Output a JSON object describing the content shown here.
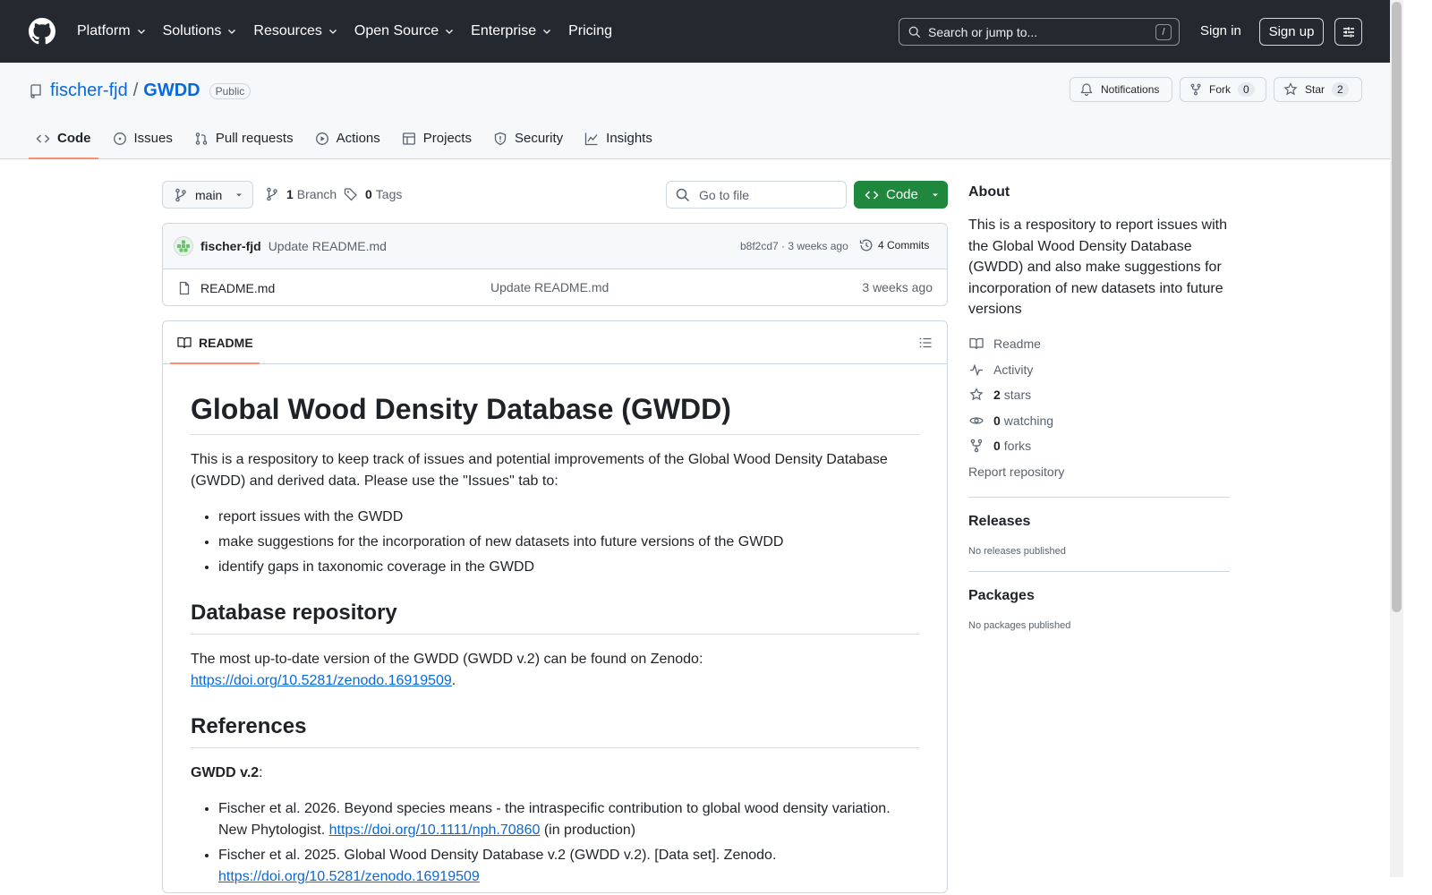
{
  "header": {
    "nav": [
      "Platform",
      "Solutions",
      "Resources",
      "Open Source",
      "Enterprise"
    ],
    "pricing": "Pricing",
    "search_placeholder": "Search or jump to...",
    "search_shortcut": "/",
    "sign_in": "Sign in",
    "sign_up": "Sign up"
  },
  "repo": {
    "owner": "fischer-fjd",
    "separator": "/",
    "name": "GWDD",
    "visibility": "Public",
    "notifications_label": "Notifications",
    "fork_label": "Fork",
    "fork_count": "0",
    "star_label": "Star",
    "star_count": "2",
    "tabs": [
      "Code",
      "Issues",
      "Pull requests",
      "Actions",
      "Projects",
      "Security",
      "Insights"
    ]
  },
  "toolbar": {
    "branch": "main",
    "branch_count": "1",
    "branch_label": "Branch",
    "tag_count": "0",
    "tag_label": "Tags",
    "goto_placeholder": "Go to file",
    "code_button": "Code"
  },
  "latest_commit": {
    "author": "fischer-fjd",
    "message": "Update README.md",
    "meta": "b8f2cd7 · 3 weeks ago",
    "commits_label": "4 Commits"
  },
  "files": [
    {
      "name": "README.md",
      "message": "Update README.md",
      "date": "3 weeks ago"
    }
  ],
  "readme": {
    "tab_label": "README",
    "title": "Global Wood Density Database (GWDD)",
    "intro": "This is a respository to keep track of issues and potential improvements of the Global Wood Density Database (GWDD) and derived data. Please use the \"Issues\" tab to:",
    "bullets": [
      "report issues with the GWDD",
      "make suggestions for the incorporation of new datasets into future versions of the GWDD",
      "identify gaps in taxonomic coverage in the GWDD"
    ],
    "h_database": "Database repository",
    "db_text": "The most up-to-date version of the GWDD (GWDD v.2) can be found on Zenodo:",
    "db_link": "https://doi.org/10.5281/zenodo.16919509",
    "db_after": ".",
    "h_references": "References",
    "ref_heading": "GWDD v.2",
    "ref_colon": ":",
    "refs": [
      {
        "text": "Fischer et al. 2026. Beyond species means - the intraspecific contribution to global wood density variation. New Phytologist.",
        "link": "https://doi.org/10.1111/nph.70860",
        "after": "(in production)"
      },
      {
        "text": "Fischer et al. 2025. Global Wood Density Database v.2 (GWDD v.2). [Data set]. Zenodo.",
        "link": "https://doi.org/10.5281/zenodo.16919509",
        "after": ""
      }
    ]
  },
  "sidebar": {
    "about_title": "About",
    "about_text": "This is a respository to report issues with the Global Wood Density Database (GWDD) and also make suggestions for incorporation of new datasets into future versions",
    "readme": "Readme",
    "activity": "Activity",
    "stars_count": "2",
    "stars_label": "stars",
    "watching_count": "0",
    "watching_label": "watching",
    "forks_count": "0",
    "forks_label": "forks",
    "report": "Report repository",
    "releases_title": "Releases",
    "releases_text": "No releases published",
    "packages_title": "Packages",
    "packages_text": "No packages published"
  },
  "colors": {
    "header_bg": "#24292f",
    "link": "#0969da",
    "code_button": "#1f883d",
    "active_tab_underline": "#fd8c73"
  }
}
